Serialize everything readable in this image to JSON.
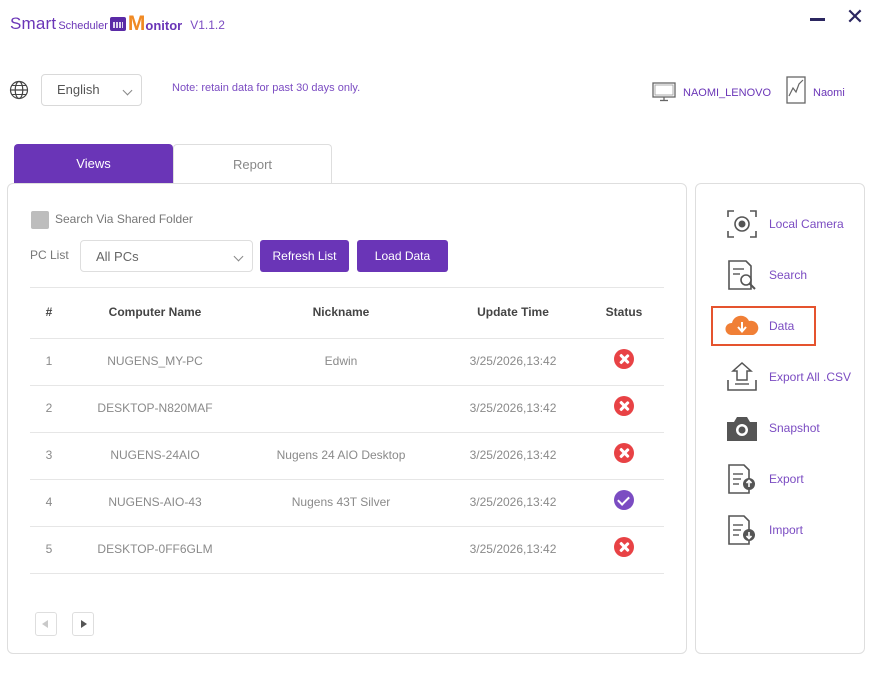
{
  "app": {
    "logo_smart": "Smart",
    "logo_scheduler": "Scheduler",
    "logo_m": "M",
    "logo_onitor": "onitor",
    "version": "V1.1.2"
  },
  "header": {
    "language": "English",
    "note": "Note: retain data for past 30 days only.",
    "pc_name": "NAOMI_LENOVO",
    "user_name": "Naomi"
  },
  "tabs": [
    {
      "label": "Views",
      "active": true
    },
    {
      "label": "Report",
      "active": false
    }
  ],
  "filters": {
    "checkbox_label": "Search Via Shared Folder",
    "pclist_label": "PC List",
    "pclist_value": "All PCs",
    "refresh_label": "Refresh List",
    "load_label": "Load Data"
  },
  "table": {
    "headers": [
      "#",
      "Computer Name",
      "Nickname",
      "Update Time",
      "Status"
    ],
    "rows": [
      {
        "num": "1",
        "name": "NUGENS_MY-PC",
        "nickname": "Edwin",
        "time": "3/25/2026,13:42",
        "status": "offline"
      },
      {
        "num": "2",
        "name": "DESKTOP-N820MAF",
        "nickname": "",
        "time": "3/25/2026,13:42",
        "status": "offline"
      },
      {
        "num": "3",
        "name": "NUGENS-24AIO",
        "nickname": "Nugens 24 AIO Desktop",
        "time": "3/25/2026,13:42",
        "status": "offline"
      },
      {
        "num": "4",
        "name": "NUGENS-AIO-43",
        "nickname": "Nugens 43T Silver",
        "time": "3/25/2026,13:42",
        "status": "online"
      },
      {
        "num": "5",
        "name": "DESKTOP-0FF6GLM",
        "nickname": "",
        "time": "3/25/2026,13:42",
        "status": "offline"
      }
    ]
  },
  "sidebar": {
    "items": [
      {
        "label": "Local Camera",
        "icon": "camera-icon"
      },
      {
        "label": "Search",
        "icon": "search-doc-icon"
      },
      {
        "label": "Data",
        "icon": "cloud-download-icon",
        "highlighted": true
      },
      {
        "label": "Export All .CSV",
        "icon": "upload-tray-icon"
      },
      {
        "label": "Snapshot",
        "icon": "snapshot-camera-icon"
      },
      {
        "label": "Export",
        "icon": "export-doc-icon"
      },
      {
        "label": "Import",
        "icon": "import-doc-icon"
      }
    ]
  },
  "colors": {
    "accent": "#6a35b7",
    "offline": "#e84245",
    "online": "#7b4cc2",
    "highlight_border": "#e5532e",
    "cloud": "#f07f36"
  }
}
